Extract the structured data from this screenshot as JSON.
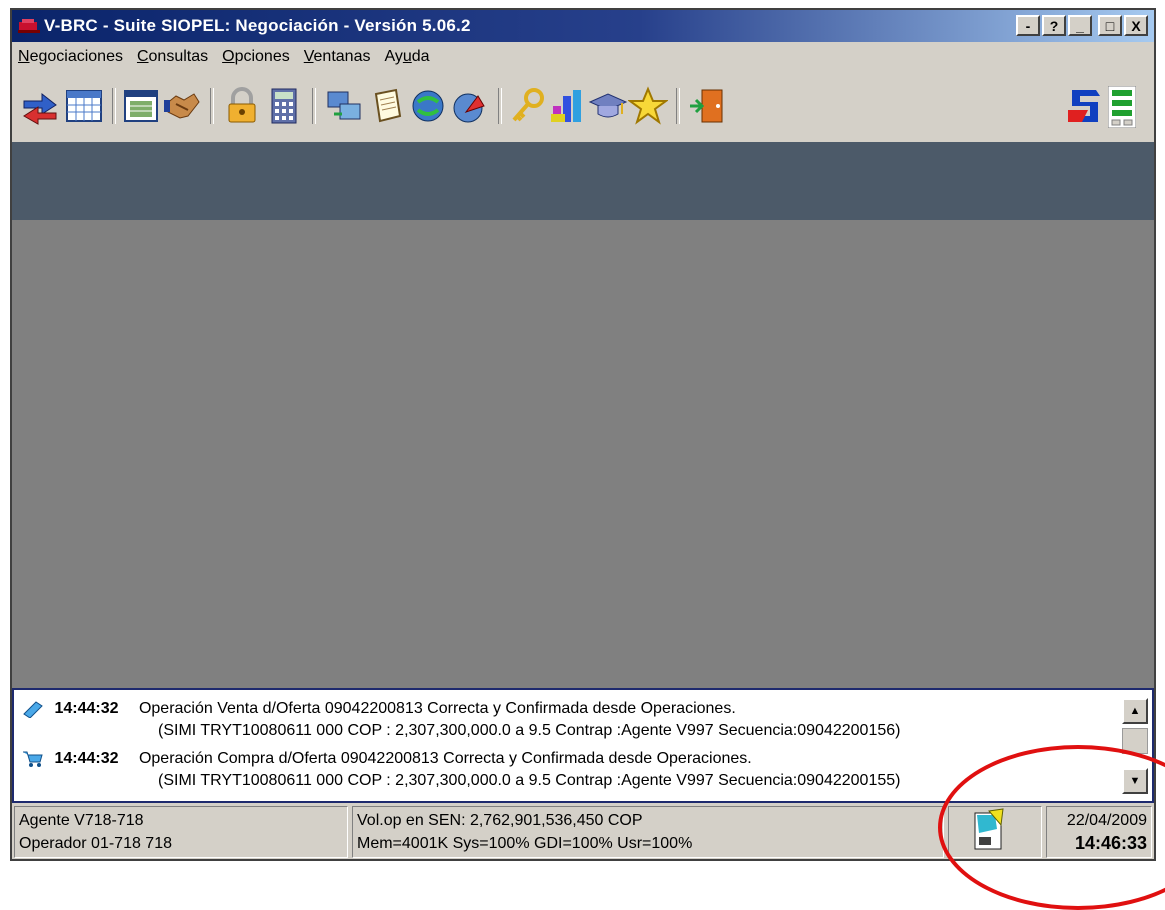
{
  "window": {
    "title": "V-BRC - Suite SIOPEL: Negociación - Versión 5.06.2",
    "buttons": [
      "-",
      "?",
      "_",
      "□",
      "X"
    ]
  },
  "menubar": {
    "items": [
      {
        "key": "N",
        "rest": "egociaciones"
      },
      {
        "key": "C",
        "rest": "onsultas"
      },
      {
        "key": "O",
        "rest": "pciones"
      },
      {
        "key": "V",
        "rest": "entanas"
      },
      {
        "pre": "Ay",
        "key": "u",
        "rest": "da"
      }
    ]
  },
  "toolbar": {
    "icons": [
      "transfer-arrows-icon",
      "calendar-grid-icon",
      "window-list-icon",
      "handshake-icon",
      "padlock-icon",
      "calculator-icon",
      "monitor-transfer-icon",
      "document-icon",
      "refresh-globe-icon",
      "upload-globe-icon",
      "key-icon",
      "bar-chart-icon",
      "graduation-cap-icon",
      "star-icon",
      "exit-door-icon",
      "siopel-logo-icon",
      "status-lights-icon"
    ]
  },
  "messages": [
    {
      "icon": "pencil-sell-icon",
      "time": "14:44:32",
      "text": "Operación Venta d/Oferta 09042200813 Correcta y Confirmada desde Operaciones.",
      "detail": "(SIMI TRYT10080611 000 COP : 2,307,300,000.0 a 9.5 Contrap :Agente V997 Secuencia:09042200156)"
    },
    {
      "icon": "cart-buy-icon",
      "time": "14:44:32",
      "text": "Operación Compra d/Oferta 09042200813 Correcta y Confirmada desde Operaciones.",
      "detail": "(SIMI TRYT10080611 000 COP : 2,307,300,000.0 a 9.5 Contrap :Agente V997 Secuencia:09042200155)"
    }
  ],
  "status": {
    "agent": "Agente V718-718",
    "operator": "Operador 01-718 718",
    "volume": "Vol.op en SEN:  2,762,901,536,450 COP",
    "memory": "Mem=4001K Sys=100% GDI=100% Usr=100%",
    "date": "22/04/2009",
    "time": "14:46:33"
  },
  "colors": {
    "title_gradient_start": "#0a246a",
    "dark_band": "#4c5a69",
    "workspace": "#808080",
    "highlight_circle": "#e01010"
  }
}
